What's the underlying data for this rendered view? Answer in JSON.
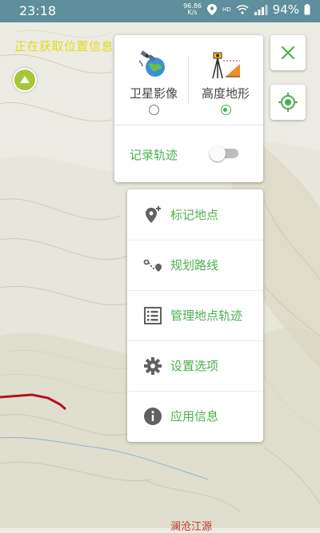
{
  "status_bar": {
    "time": "23:18",
    "net_speed_value": "96.86",
    "net_speed_unit": "K/s",
    "hd": "HD",
    "battery": "94%"
  },
  "map": {
    "locating_text": "正在获取位置信息",
    "bottom_label": "澜沧江源"
  },
  "layers": {
    "options": [
      {
        "label": "卫星影像",
        "selected": false
      },
      {
        "label": "高度地形",
        "selected": true
      }
    ],
    "record_track_label": "记录轨迹",
    "record_track_on": false
  },
  "menu": {
    "items": [
      {
        "label": "标记地点",
        "icon": "add-location-icon"
      },
      {
        "label": "规划路线",
        "icon": "route-icon"
      },
      {
        "label": "管理地点轨迹",
        "icon": "list-icon"
      },
      {
        "label": "设置选项",
        "icon": "gear-icon"
      },
      {
        "label": "应用信息",
        "icon": "info-icon"
      }
    ]
  },
  "colors": {
    "accent": "#4caf50",
    "status_bar": "#5f8f9c",
    "locating_text": "#e2dd1a",
    "track_line": "#b3121b"
  }
}
